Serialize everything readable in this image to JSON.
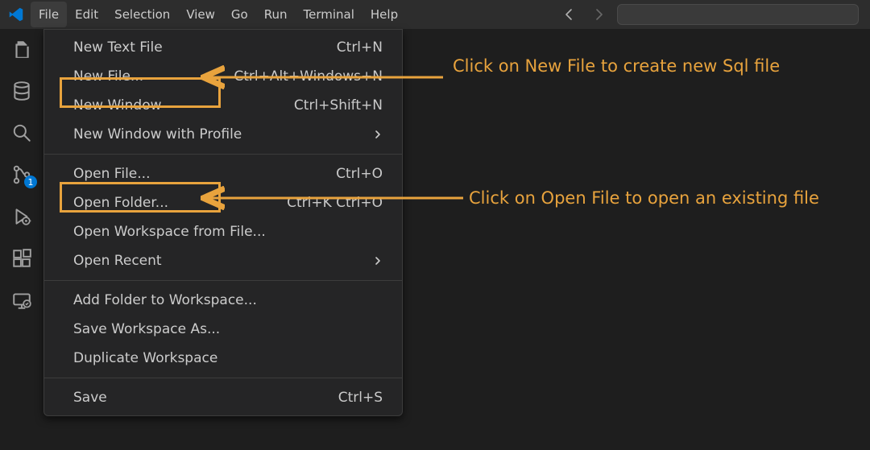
{
  "menubar": {
    "items": [
      "File",
      "Edit",
      "Selection",
      "View",
      "Go",
      "Run",
      "Terminal",
      "Help"
    ],
    "open_index": 0
  },
  "activitybar": {
    "source_control_badge": "1"
  },
  "file_menu": {
    "items": [
      {
        "label": "New Text File",
        "shortcut": "Ctrl+N",
        "submenu": false
      },
      {
        "label": "New File...",
        "shortcut": "Ctrl+Alt+Windows+N",
        "submenu": false
      },
      {
        "label": "New Window",
        "shortcut": "Ctrl+Shift+N",
        "submenu": false
      },
      {
        "label": "New Window with Profile",
        "shortcut": "",
        "submenu": true
      },
      {
        "sep": true
      },
      {
        "label": "Open File...",
        "shortcut": "Ctrl+O",
        "submenu": false
      },
      {
        "label": "Open Folder...",
        "shortcut": "Ctrl+K Ctrl+O",
        "submenu": false
      },
      {
        "label": "Open Workspace from File...",
        "shortcut": "",
        "submenu": false
      },
      {
        "label": "Open Recent",
        "shortcut": "",
        "submenu": true
      },
      {
        "sep": true
      },
      {
        "label": "Add Folder to Workspace...",
        "shortcut": "",
        "submenu": false
      },
      {
        "label": "Save Workspace As...",
        "shortcut": "",
        "submenu": false
      },
      {
        "label": "Duplicate Workspace",
        "shortcut": "",
        "submenu": false
      },
      {
        "sep": true
      },
      {
        "label": "Save",
        "shortcut": "Ctrl+S",
        "submenu": false
      }
    ]
  },
  "annotations": {
    "newfile": "Click on New File to create new Sql file",
    "openfile": "Click on Open File to open an existing file"
  }
}
